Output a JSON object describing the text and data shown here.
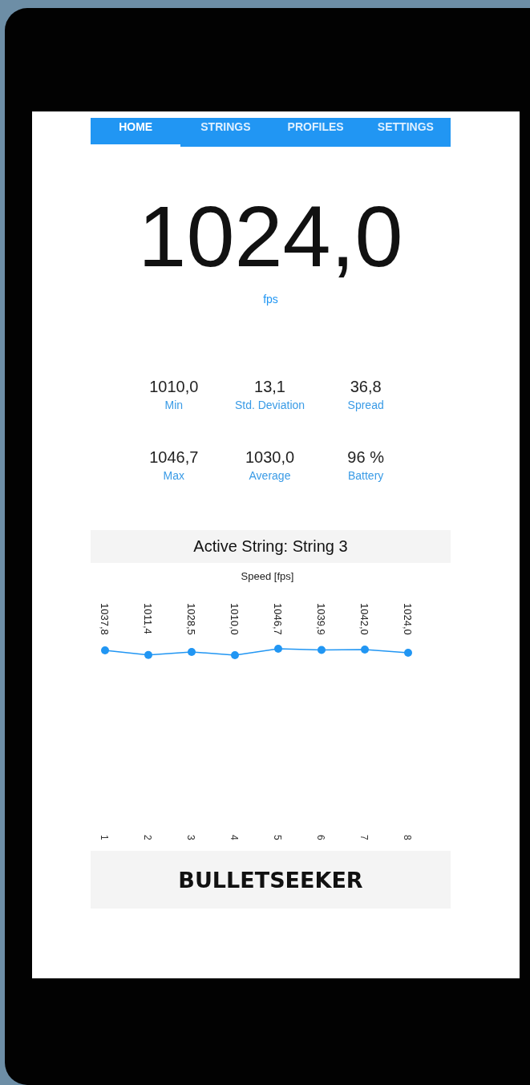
{
  "tabs": [
    {
      "label": "HOME",
      "selected": true
    },
    {
      "label": "STRINGS",
      "selected": false
    },
    {
      "label": "PROFILES",
      "selected": false
    },
    {
      "label": "SETTINGS",
      "selected": false
    }
  ],
  "reading": {
    "value": "1024,0",
    "unit": "fps"
  },
  "stats": [
    {
      "value": "1010,0",
      "label": "Min"
    },
    {
      "value": "13,1",
      "label": "Std. Deviation"
    },
    {
      "value": "36,8",
      "label": "Spread"
    },
    {
      "value": "1046,7",
      "label": "Max"
    },
    {
      "value": "1030,0",
      "label": "Average"
    },
    {
      "value": "96 %",
      "label": "Battery"
    }
  ],
  "active_string": "Active String: String 3",
  "chart_data": {
    "type": "line",
    "title": "Speed [fps]",
    "categories": [
      "1",
      "2",
      "3",
      "4",
      "5",
      "6",
      "7",
      "8"
    ],
    "series": [
      {
        "color": "#2196f3",
        "marker": "circle",
        "values": [
          1037.8,
          1011.4,
          1028.5,
          1010.0,
          1046.7,
          1039.9,
          1042.0,
          1024.0
        ],
        "value_labels": [
          "1037,8",
          "1011,4",
          "1028,5",
          "1010,0",
          "1046,7",
          "1039,9",
          "1042,0",
          "1024,0"
        ]
      }
    ],
    "data_labels": true
  },
  "footer": {
    "brand": "BULLETSEEKER"
  }
}
